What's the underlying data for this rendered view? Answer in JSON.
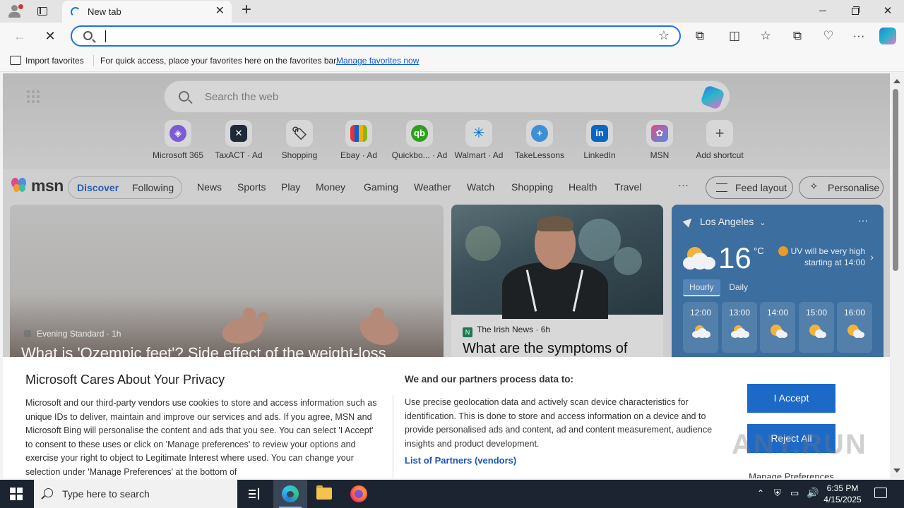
{
  "browser": {
    "tab_title": "New tab",
    "address_value": "",
    "favorites_bar": {
      "import_label": "Import favorites",
      "message": "For quick access, place your favorites here on the favorites bar.",
      "manage_link": "Manage favorites now"
    }
  },
  "msn": {
    "search_placeholder": "Search the web",
    "shortcuts": [
      {
        "label": "Microsoft 365",
        "icon": "m365-icon",
        "color": "#7b5bd6"
      },
      {
        "label": "TaxACT · Ad",
        "icon": "taxact-icon",
        "color": "#1e2a3a"
      },
      {
        "label": "Shopping",
        "icon": "tag-icon",
        "color": "#d7d7d7"
      },
      {
        "label": "Ebay · Ad",
        "icon": "ebay-icon",
        "color": "#e53238"
      },
      {
        "label": "Quickbo... · Ad",
        "icon": "quickbooks-icon",
        "color": "#2ca01c"
      },
      {
        "label": "Walmart · Ad",
        "icon": "walmart-icon",
        "color": "#0071ce"
      },
      {
        "label": "TakeLessons",
        "icon": "takelessons-icon",
        "color": "#3f8fd6"
      },
      {
        "label": "LinkedIn",
        "icon": "linkedin-icon",
        "color": "#0a66c2"
      },
      {
        "label": "MSN",
        "icon": "msn-icon",
        "color": "#4b8fe8"
      },
      {
        "label": "Add shortcut",
        "icon": "plus-icon",
        "color": "#d7d7d7"
      }
    ],
    "logo_text": "msn",
    "tabs": {
      "discover": "Discover",
      "following": "Following"
    },
    "nav": [
      "News",
      "Sports",
      "Play",
      "Money",
      "Gaming",
      "Weather",
      "Watch",
      "Shopping",
      "Health",
      "Travel"
    ],
    "more": "···",
    "feed_layout": "Feed layout",
    "personalise": "Personalise",
    "hero": {
      "source": "Evening Standard",
      "age": "1h",
      "headline": "What is 'Ozempic feet'? Side effect of the weight-loss"
    },
    "news": {
      "source": "The Irish News",
      "age": "6h",
      "headline": "What are the symptoms of"
    },
    "weather": {
      "location": "Los Angeles",
      "temp": "16",
      "unit": "°C",
      "uv_text": "UV will be very high starting at 14:00",
      "tab_hourly": "Hourly",
      "tab_daily": "Daily",
      "hours": [
        "12:00",
        "13:00",
        "14:00",
        "15:00",
        "16:00"
      ],
      "more": "···"
    }
  },
  "privacy": {
    "title": "Microsoft Cares About Your Privacy",
    "body": "Microsoft and our third-party vendors use cookies to store and access information such as unique IDs to deliver, maintain and improve our services and ads. If you agree, MSN and Microsoft Bing will personalise the content and ads that you see. You can select 'I Accept' to consent to these uses or click on 'Manage preferences' to review your options and exercise your right to object to Legitimate Interest where used.  You can change your selection under 'Manage Preferences' at the bottom of",
    "partners_title": "We and our partners process data to:",
    "partners_body": "Use precise geolocation data and actively scan device characteristics for identification. This is done to store and access information on a device and to provide personalised ads and content, ad and content measurement, audience insights and product development.",
    "partners_link": "List of Partners (vendors)",
    "accept": "I Accept",
    "reject": "Reject All",
    "manage": "Manage Preferences"
  },
  "watermark": "ANY.RUN",
  "taskbar": {
    "search_placeholder": "Type here to search",
    "time": "6:35 PM",
    "date": "4/15/2025"
  }
}
